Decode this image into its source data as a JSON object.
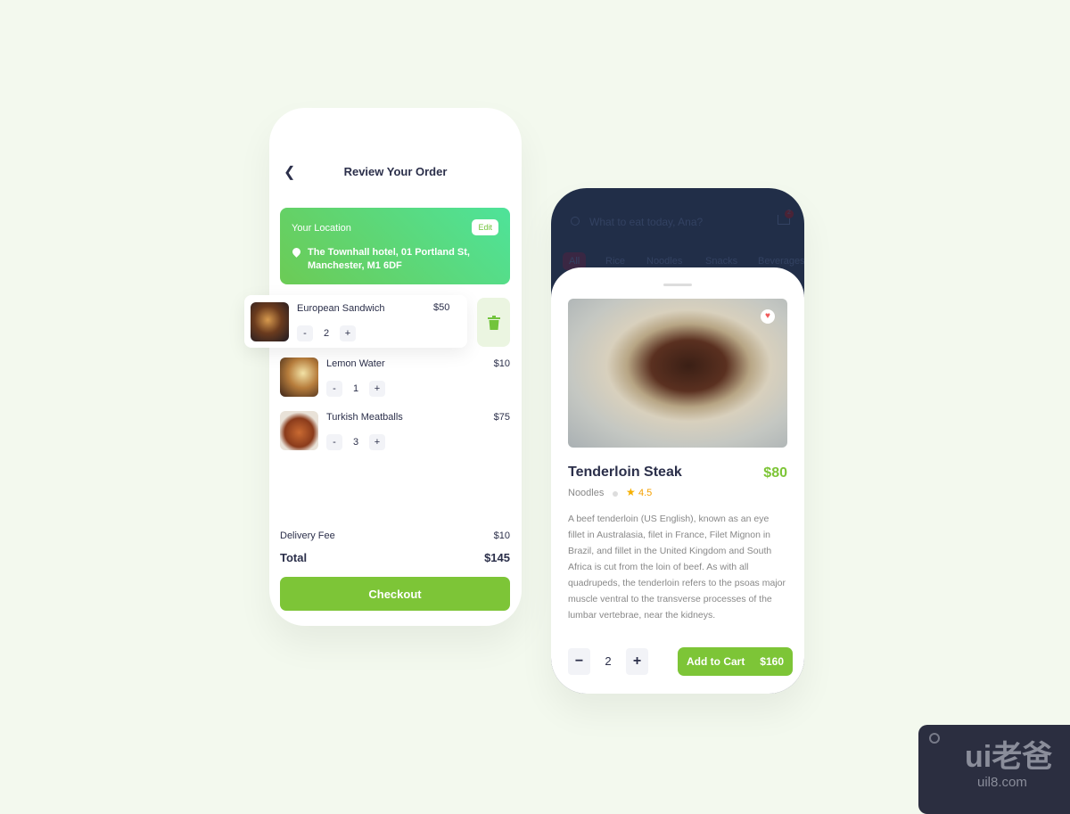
{
  "order": {
    "title": "Review Your Order",
    "location": {
      "label": "Your Location",
      "edit": "Edit",
      "address": "The Townhall hotel, 01 Portland St, Manchester, M1 6DF"
    },
    "items": [
      {
        "name": "European Sandwich",
        "price": "$50",
        "qty": "2"
      },
      {
        "name": "Lemon Water",
        "price": "$10",
        "qty": "1"
      },
      {
        "name": "Turkish Meatballs",
        "price": "$75",
        "qty": "3"
      }
    ],
    "minus": "-",
    "plus": "+",
    "delivery_label": "Delivery Fee",
    "delivery_value": "$10",
    "total_label": "Total",
    "total_value": "$145",
    "checkout": "Checkout"
  },
  "detail": {
    "search_placeholder": "What to eat today, Ana?",
    "cart_count": "2",
    "categories": [
      "All",
      "Rice",
      "Noodles",
      "Snacks",
      "Beverages"
    ],
    "name": "Tenderloin Steak",
    "price": "$80",
    "category": "Noodles",
    "rating": "4.5",
    "description": "A beef tenderloin (US English), known as an eye fillet in Australasia, filet in France, Filet Mignon in Brazil, and fillet in the United Kingdom and South Africa is cut from the loin of beef. As with all quadrupeds, the tenderloin refers to the psoas major muscle ventral to the transverse processes of the lumbar vertebrae, near the kidneys.",
    "qty": "2",
    "minus": "−",
    "plus": "+",
    "add_to_cart": "Add to Cart",
    "add_price": "$160"
  },
  "watermark": {
    "brand": "ui老爸",
    "site": "uil8.com"
  },
  "colors": {
    "accent": "#7dc537",
    "dark": "#212e48",
    "text": "#2b2f4a"
  }
}
